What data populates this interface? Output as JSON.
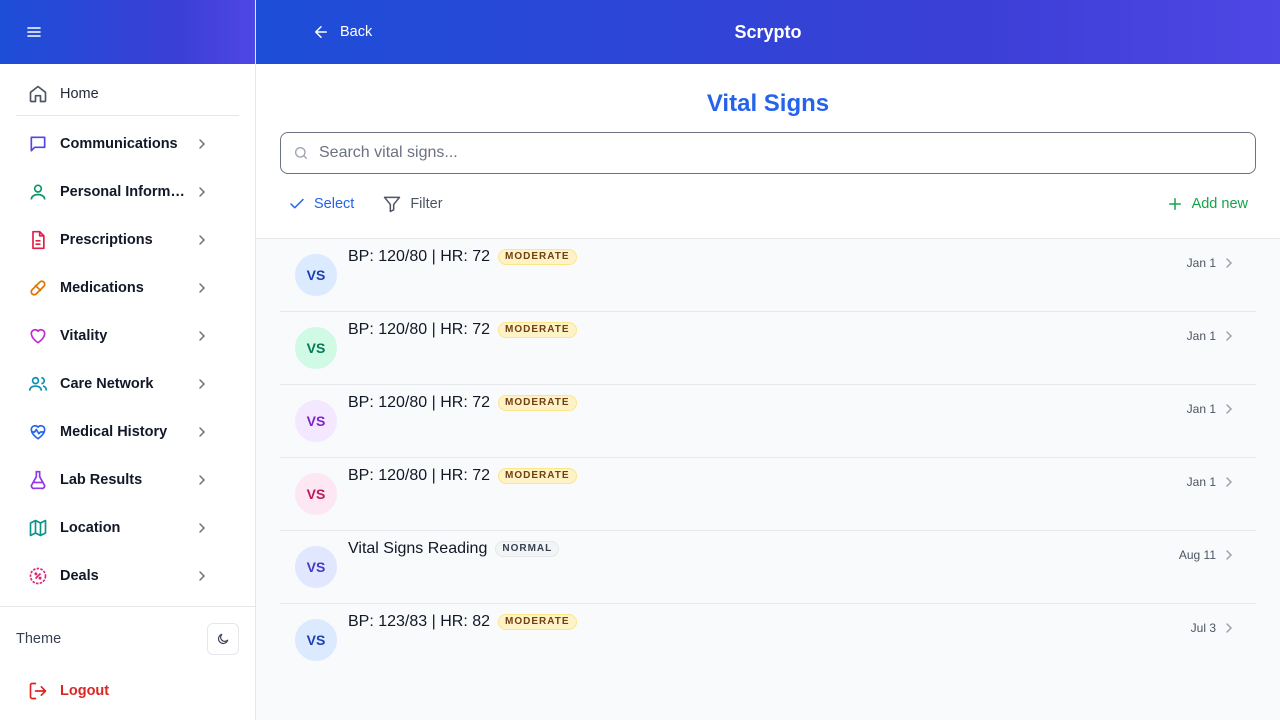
{
  "app": {
    "title": "Scrypto",
    "back_label": "Back"
  },
  "sidebar": {
    "items": [
      {
        "label": "Home",
        "icon": "home-icon",
        "color": "#4b5563"
      },
      {
        "label": "Communications",
        "icon": "message-icon",
        "color": "#4f46e5"
      },
      {
        "label": "Personal Information",
        "icon": "user-icon",
        "color": "#059669"
      },
      {
        "label": "Prescriptions",
        "icon": "document-icon",
        "color": "#e11d48"
      },
      {
        "label": "Medications",
        "icon": "pill-icon",
        "color": "#d97706"
      },
      {
        "label": "Vitality",
        "icon": "heart-icon",
        "color": "#c026d3"
      },
      {
        "label": "Care Network",
        "icon": "users-icon",
        "color": "#0891b2"
      },
      {
        "label": "Medical History",
        "icon": "heart-pulse-icon",
        "color": "#2563eb"
      },
      {
        "label": "Lab Results",
        "icon": "flask-icon",
        "color": "#9333ea"
      },
      {
        "label": "Location",
        "icon": "map-icon",
        "color": "#0d9488"
      },
      {
        "label": "Deals",
        "icon": "badge-percent-icon",
        "color": "#db2777"
      }
    ],
    "theme_label": "Theme",
    "logout_label": "Logout"
  },
  "page": {
    "title": "Vital Signs",
    "search_placeholder": "Search vital signs...",
    "select_label": "Select",
    "filter_label": "Filter",
    "add_label": "Add new"
  },
  "records": [
    {
      "initials": "VS",
      "title": "BP: 120/80 | HR: 72",
      "badge": "MODERATE",
      "badge_type": "moderate",
      "date": "Jan 1",
      "avatar_bg": "#dbeafe",
      "avatar_fg": "#1e40af"
    },
    {
      "initials": "VS",
      "title": "BP: 120/80 | HR: 72",
      "badge": "MODERATE",
      "badge_type": "moderate",
      "date": "Jan 1",
      "avatar_bg": "#d1fae5",
      "avatar_fg": "#047857"
    },
    {
      "initials": "VS",
      "title": "BP: 120/80 | HR: 72",
      "badge": "MODERATE",
      "badge_type": "moderate",
      "date": "Jan 1",
      "avatar_bg": "#f3e8ff",
      "avatar_fg": "#7e22ce"
    },
    {
      "initials": "VS",
      "title": "BP: 120/80 | HR: 72",
      "badge": "MODERATE",
      "badge_type": "moderate",
      "date": "Jan 1",
      "avatar_bg": "#fce7f3",
      "avatar_fg": "#be185d"
    },
    {
      "initials": "VS",
      "title": "Vital Signs Reading",
      "badge": "NORMAL",
      "badge_type": "normal",
      "date": "Aug 11",
      "avatar_bg": "#e0e7ff",
      "avatar_fg": "#4338ca"
    },
    {
      "initials": "VS",
      "title": "BP: 123/83 | HR: 82",
      "badge": "MODERATE",
      "badge_type": "moderate",
      "date": "Jul 3",
      "avatar_bg": "#dbeafe",
      "avatar_fg": "#1e40af"
    }
  ]
}
